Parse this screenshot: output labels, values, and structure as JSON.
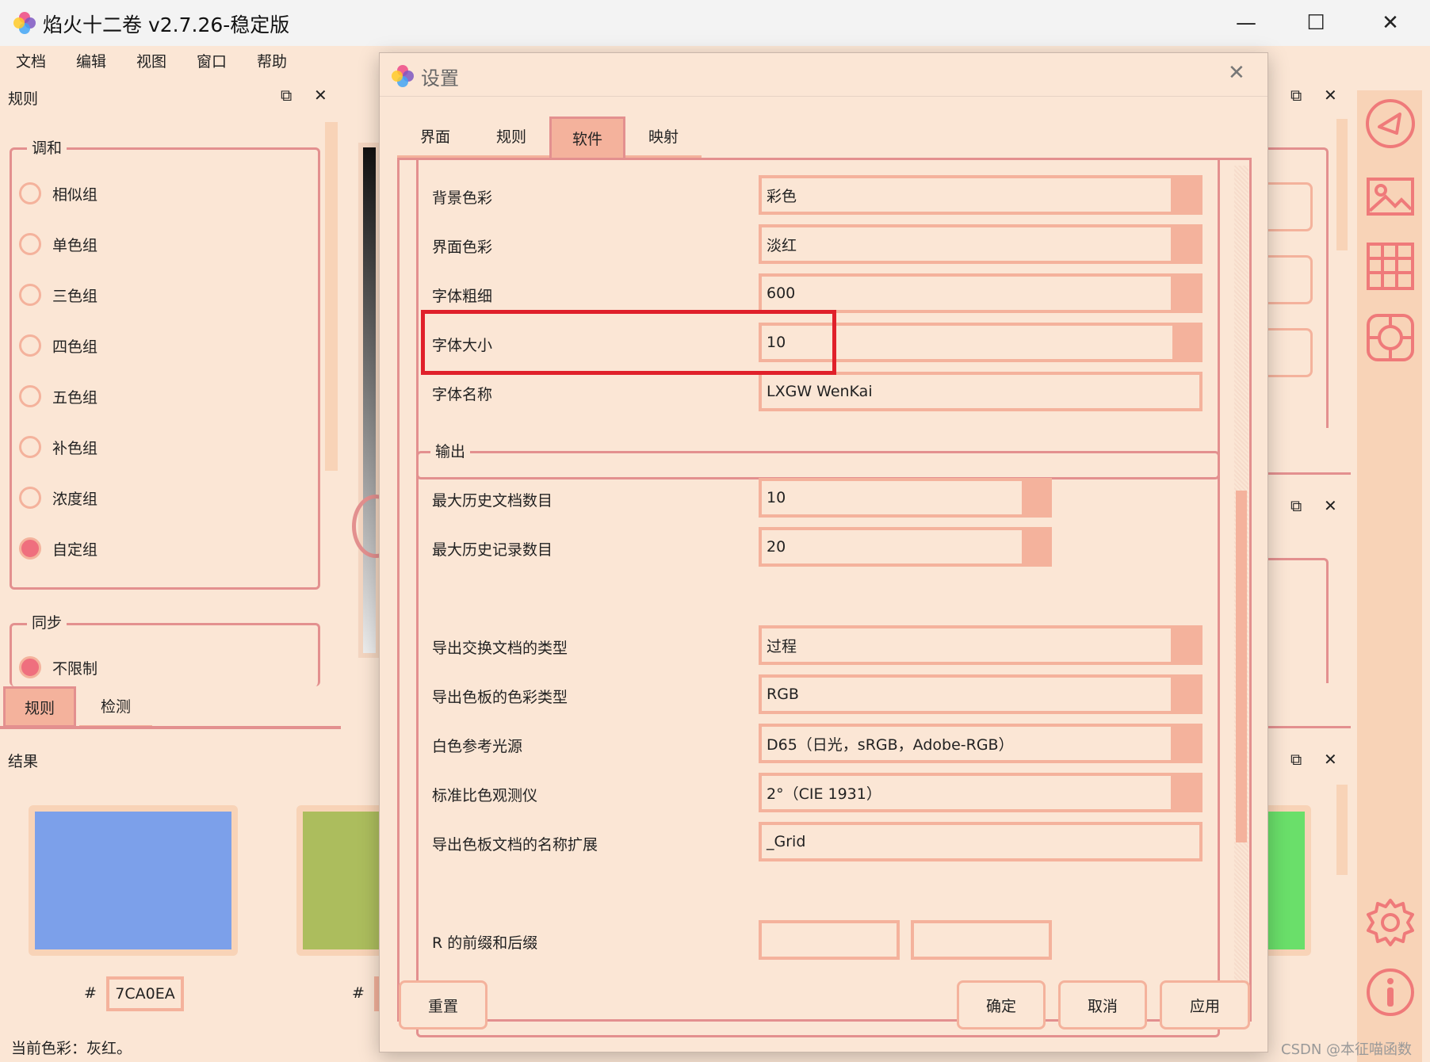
{
  "window": {
    "title": "焰火十二卷 v2.7.26-稳定版",
    "minimize": "—",
    "maximize": "☐",
    "close": "✕"
  },
  "menu": [
    "文档",
    "编辑",
    "视图",
    "窗口",
    "帮助"
  ],
  "rules_panel": {
    "title": "规则",
    "harmony_group": "调和",
    "harmony_options": [
      {
        "label": "相似组",
        "selected": false
      },
      {
        "label": "单色组",
        "selected": false
      },
      {
        "label": "三色组",
        "selected": false
      },
      {
        "label": "四色组",
        "selected": false
      },
      {
        "label": "五色组",
        "selected": false
      },
      {
        "label": "补色组",
        "selected": false
      },
      {
        "label": "浓度组",
        "selected": false
      },
      {
        "label": "自定组",
        "selected": true
      }
    ],
    "sync_group": "同步",
    "sync_option": "不限制",
    "bottom_tabs": [
      "规则",
      "检测"
    ]
  },
  "results_panel": {
    "title": "结果",
    "hash": "#",
    "hex_value": "7CA0EA",
    "hash2": "#",
    "swatches": [
      "#7ca0ea",
      "#acbd5d",
      "#6adf6a"
    ],
    "status": "当前色彩：灰红。"
  },
  "dialog": {
    "title": "设置",
    "close": "✕",
    "tabs": [
      "界面",
      "规则",
      "软件",
      "映射"
    ],
    "active_tab": "软件",
    "appearance_rows": [
      {
        "label": "背景色彩",
        "value": "彩色"
      },
      {
        "label": "界面色彩",
        "value": "淡红"
      },
      {
        "label": "字体粗细",
        "value": "600"
      },
      {
        "label": "字体大小",
        "value": "10"
      },
      {
        "label": "字体名称",
        "value": "LXGW WenKai"
      }
    ],
    "output_group": "输出",
    "output_spins": [
      {
        "label": "最大历史文档数目",
        "value": "10"
      },
      {
        "label": "最大历史记录数目",
        "value": "20"
      }
    ],
    "output_rows": [
      {
        "label": "导出交换文档的类型",
        "value": "过程"
      },
      {
        "label": "导出色板的色彩类型",
        "value": "RGB"
      },
      {
        "label": "白色参考光源",
        "value": "D65（日光，sRGB，Adobe-RGB）"
      },
      {
        "label": "标准比色观测仪",
        "value": "2°（CIE 1931）"
      },
      {
        "label": "导出色板文档的名称扩展",
        "value": "_Grid"
      }
    ],
    "prefix_label": "R 的前缀和后缀",
    "prefix_value": "",
    "suffix_value": "",
    "buttons": {
      "reset": "重置",
      "ok": "确定",
      "cancel": "取消",
      "apply": "应用"
    }
  },
  "watermark": "CSDN @本征喵函数",
  "colors": {
    "accent": "#e3908f",
    "fill": "#f4b29c",
    "bg": "#fbe6d5",
    "highlight": "#e0202a"
  }
}
